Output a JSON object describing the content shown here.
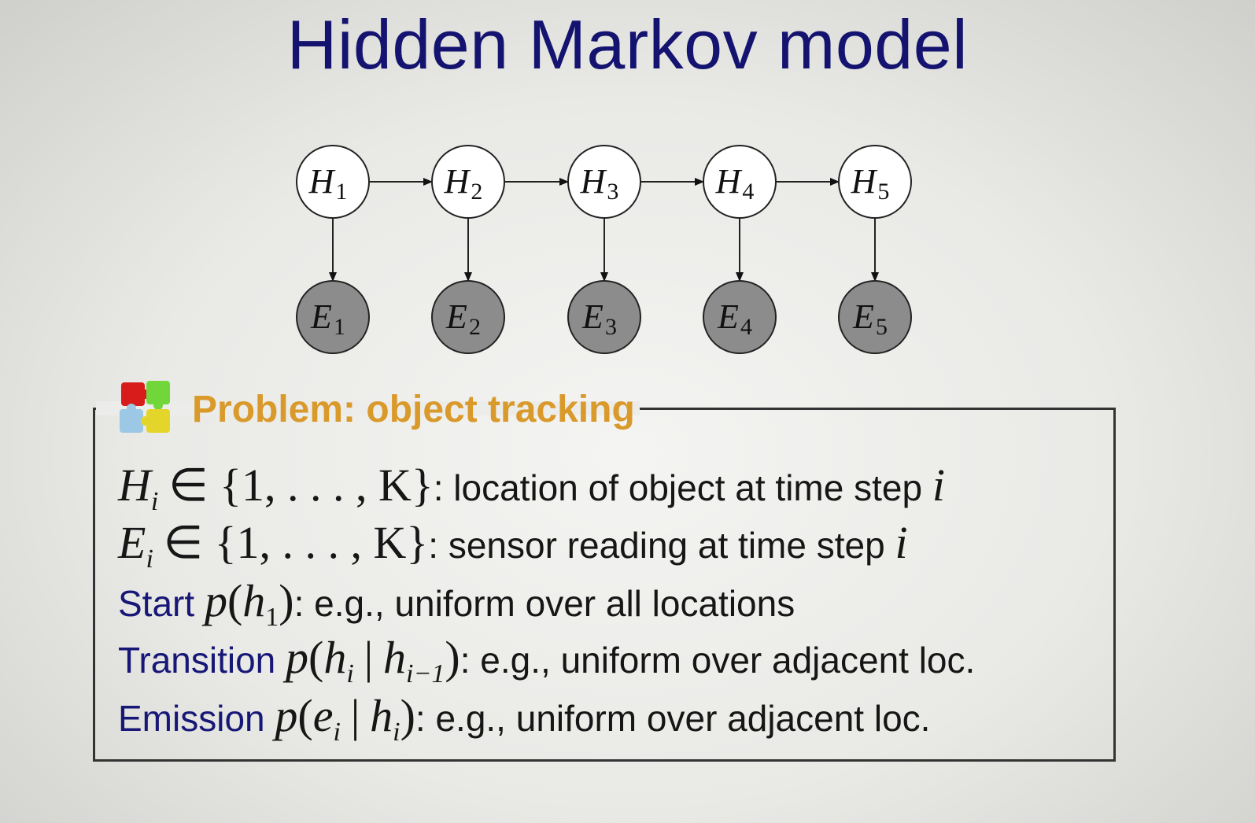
{
  "title": "Hidden Markov model",
  "hidden_nodes": [
    {
      "letter": "H",
      "index": "1"
    },
    {
      "letter": "H",
      "index": "2"
    },
    {
      "letter": "H",
      "index": "3"
    },
    {
      "letter": "H",
      "index": "4"
    },
    {
      "letter": "H",
      "index": "5"
    }
  ],
  "evidence_nodes": [
    {
      "letter": "E",
      "index": "1"
    },
    {
      "letter": "E",
      "index": "2"
    },
    {
      "letter": "E",
      "index": "3"
    },
    {
      "letter": "E",
      "index": "4"
    },
    {
      "letter": "E",
      "index": "5"
    }
  ],
  "colors": {
    "title": "#141470",
    "hidden_fill": "#ffffff",
    "evidence_fill": "#8c8c8c",
    "problem_heading": "#d99a2b",
    "keyword": "#171777"
  },
  "problem": {
    "icon": "puzzle-icon",
    "heading": "Problem: object tracking",
    "lines": {
      "h_def": {
        "math_var": "H",
        "math_sub": "i",
        "math_set": "∈ {1, . . . , K}",
        "text": ": location of object at time step ",
        "tail_var": "i"
      },
      "e_def": {
        "math_var": "E",
        "math_sub": "i",
        "math_set": "∈ {1, . . . , K}",
        "text": ": sensor reading at time step ",
        "tail_var": "i"
      },
      "start": {
        "keyword": "Start",
        "p": "p",
        "open": "(",
        "var": "h",
        "sub": "1",
        "close": ")",
        "text": ": e.g., uniform over all locations"
      },
      "transition": {
        "keyword": "Transition",
        "p": "p",
        "open": "(",
        "var": "h",
        "sub": "i",
        "bar": "|",
        "var2": "h",
        "sub2": "i−1",
        "close": ")",
        "text": ": e.g., uniform over adjacent loc."
      },
      "emission": {
        "keyword": "Emission",
        "p": "p",
        "open": "(",
        "var": "e",
        "sub": "i",
        "bar": "|",
        "var2": "h",
        "sub2": "i",
        "close": ")",
        "text": ": e.g., uniform over adjacent loc."
      }
    }
  }
}
